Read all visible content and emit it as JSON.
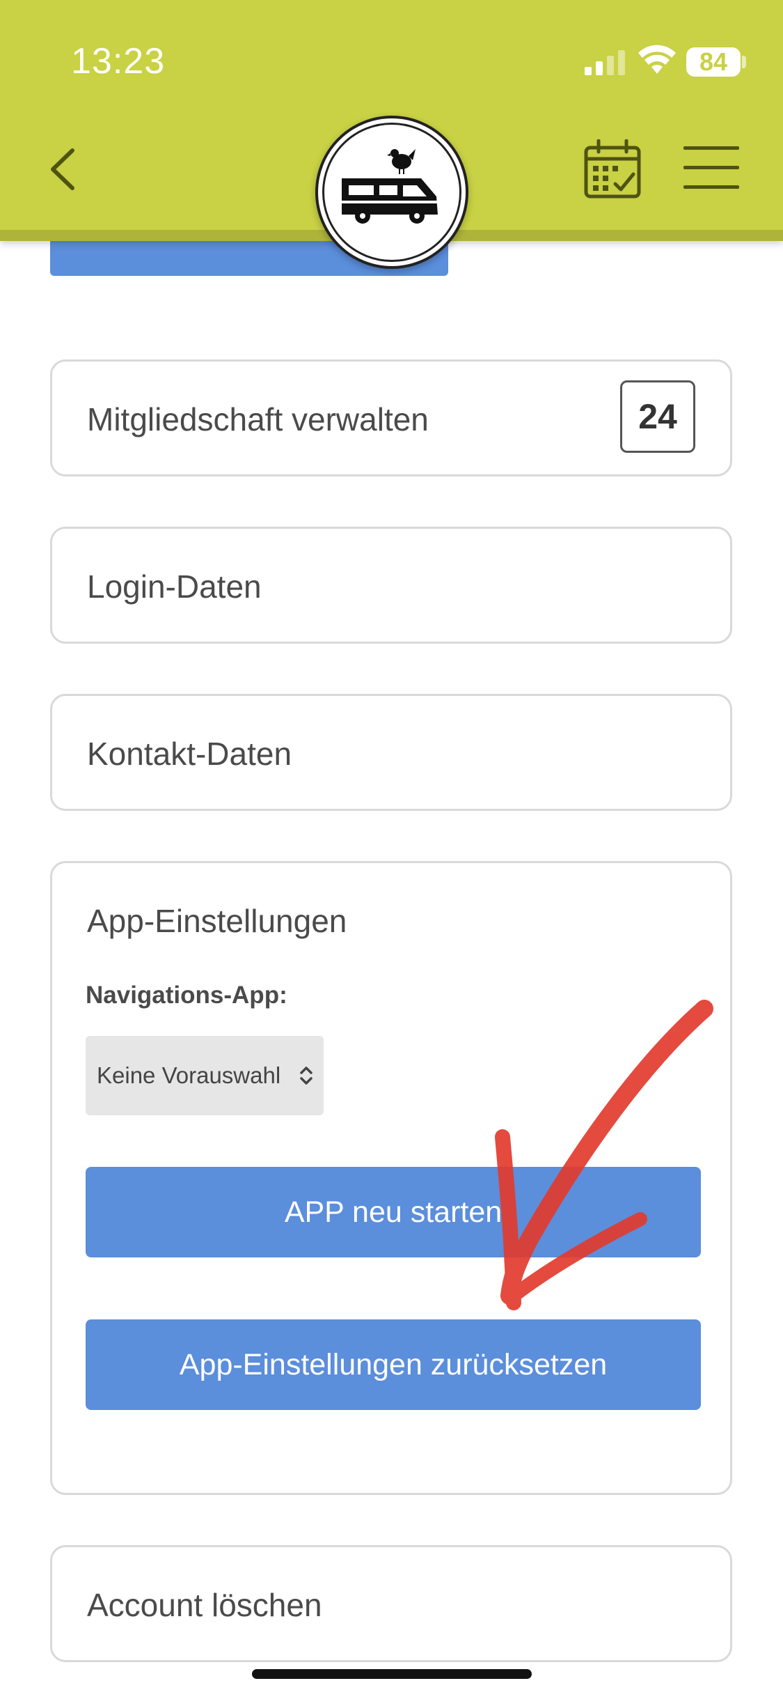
{
  "status_bar": {
    "time": "13:23",
    "battery": "84"
  },
  "header": {
    "back_icon": "chevron-left-icon",
    "logo_icon": "camper-van-chicken-logo",
    "calendar_icon": "calendar-check-icon",
    "menu_icon": "hamburger-menu-icon",
    "background_color": "#c9d144"
  },
  "cards": {
    "membership": {
      "label": "Mitgliedschaft verwalten",
      "badge": "24"
    },
    "login": {
      "label": "Login-Daten"
    },
    "contact": {
      "label": "Kontakt-Daten"
    },
    "settings": {
      "title": "App-Einstellungen",
      "nav_label": "Navigations-App:",
      "nav_select_value": "Keine Vorauswahl",
      "restart_button": "APP neu starten",
      "reset_button": "App-Einstellungen zurücksetzen"
    },
    "delete": {
      "label": "Account löschen"
    }
  },
  "colors": {
    "button": "#5b8edb",
    "annotation_arrow": "#e23b2e"
  }
}
